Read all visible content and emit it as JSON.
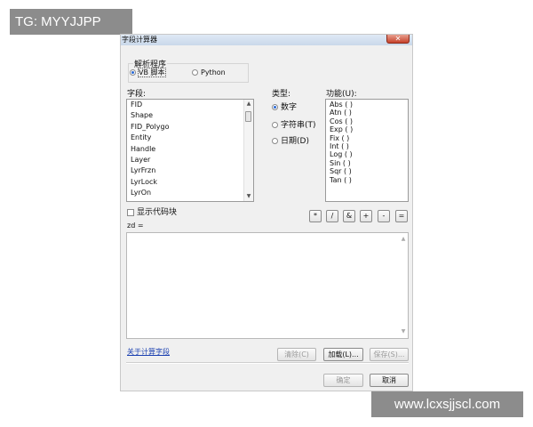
{
  "watermarks": {
    "top": "TG: MYYJJPP",
    "bottom": "www.lcxsjjscl.com"
  },
  "dialog": {
    "title": "字段计算器",
    "close_glyph": "✕"
  },
  "parser": {
    "label": "解析程序",
    "options": [
      {
        "label": "VB 脚本",
        "selected": true
      },
      {
        "label": "Python",
        "selected": false
      }
    ]
  },
  "fields": {
    "label": "字段:",
    "items": [
      "FID",
      "Shape",
      "FID_Polygo",
      "Entity",
      "Handle",
      "Layer",
      "LyrFrzn",
      "LyrLock",
      "LyrOn"
    ]
  },
  "type": {
    "label": "类型:",
    "options": [
      {
        "label": "数字",
        "selected": true
      },
      {
        "label": "字符串(T)",
        "selected": false
      },
      {
        "label": "日期(D)",
        "selected": false
      }
    ]
  },
  "functions": {
    "label": "功能(U):",
    "items": [
      "Abs ( )",
      "Atn ( )",
      "Cos ( )",
      "Exp ( )",
      "Fix ( )",
      "Int ( )",
      "Log ( )",
      "Sin ( )",
      "Sqr ( )",
      "Tan ( )"
    ]
  },
  "show_codeblock": {
    "label": "显示代码块",
    "checked": false
  },
  "operators": [
    "*",
    "/",
    "&",
    "+",
    "-",
    "="
  ],
  "expression": {
    "label": "zd =",
    "value": ""
  },
  "footer": {
    "help_link": "关于计算字段",
    "clear": "清除(C)",
    "load": "加载(L)...",
    "save": "保存(S)...",
    "ok": "确定",
    "cancel": "取消"
  },
  "icons": {
    "scroll_up": "▲",
    "scroll_down": "▼"
  }
}
